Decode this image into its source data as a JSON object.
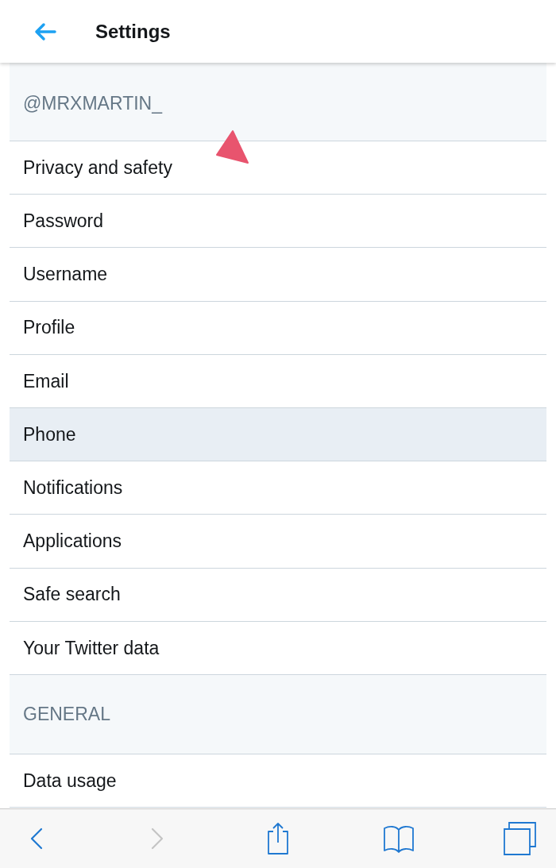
{
  "header": {
    "title": "Settings"
  },
  "sections": [
    {
      "title": "@MRXMARTIN_",
      "items": [
        {
          "label": "Privacy and safety",
          "selected": false
        },
        {
          "label": "Password",
          "selected": false
        },
        {
          "label": "Username",
          "selected": false
        },
        {
          "label": "Profile",
          "selected": false
        },
        {
          "label": "Email",
          "selected": false
        },
        {
          "label": "Phone",
          "selected": true
        },
        {
          "label": "Notifications",
          "selected": false
        },
        {
          "label": "Applications",
          "selected": false
        },
        {
          "label": "Safe search",
          "selected": false
        },
        {
          "label": "Your Twitter data",
          "selected": false
        }
      ]
    },
    {
      "title": "GENERAL",
      "items": [
        {
          "label": "Data usage",
          "selected": false
        }
      ]
    }
  ],
  "toolbar": [
    {
      "kind": "back",
      "disabled": false
    },
    {
      "kind": "forward",
      "disabled": true
    },
    {
      "kind": "share",
      "disabled": false
    },
    {
      "kind": "bookmarks",
      "disabled": false
    },
    {
      "kind": "tabs",
      "disabled": false
    }
  ]
}
